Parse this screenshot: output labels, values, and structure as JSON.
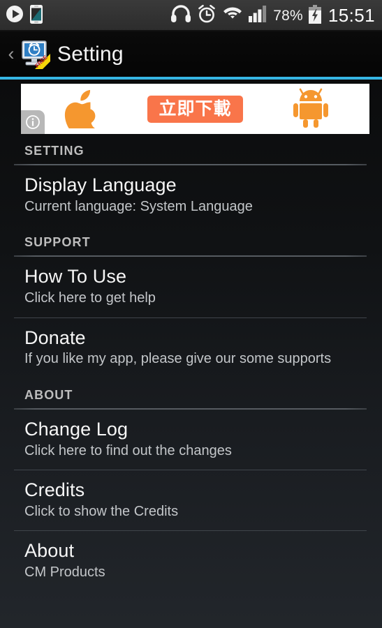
{
  "status_bar": {
    "left_icons": [
      {
        "name": "play-icon",
        "label": "play"
      },
      {
        "name": "phone-device-icon",
        "label": "device"
      }
    ],
    "right_icons": [
      {
        "name": "headphones-icon",
        "label": "headphones"
      },
      {
        "name": "alarm-clock-icon",
        "label": "alarm"
      },
      {
        "name": "wifi-icon",
        "label": "wifi"
      },
      {
        "name": "signal-bars-icon",
        "label": "signal"
      }
    ],
    "battery_percent": "78%",
    "battery_state": "charging",
    "clock": "15:51"
  },
  "action_bar": {
    "back_label": "‹",
    "app_icon_name": "monitor-alarm-clock-icon",
    "app_icon_ribbon": "FREE",
    "title": "Setting"
  },
  "ad": {
    "left_icon_name": "apple-logo-icon",
    "button_text": "立即下載",
    "right_icon_name": "android-robot-icon",
    "info_badge": "i",
    "accent_color": "#f9754a",
    "background_color": "#ffffff"
  },
  "theme": {
    "accent_line_color": "#36b6e4",
    "title_color": "#f6f6f6",
    "subtitle_color": "#c3c6c9",
    "header_color": "#bdbdbd"
  },
  "sections": [
    {
      "header": "SETTING",
      "rows": [
        {
          "title": "Display Language",
          "subtitle": "Current language: System Language"
        }
      ]
    },
    {
      "header": "SUPPORT",
      "rows": [
        {
          "title": "How To Use",
          "subtitle": "Click here to get help"
        },
        {
          "title": "Donate",
          "subtitle": "If you like my app, please give our some supports"
        }
      ]
    },
    {
      "header": "ABOUT",
      "rows": [
        {
          "title": "Change Log",
          "subtitle": "Click here to find out the changes"
        },
        {
          "title": "Credits",
          "subtitle": "Click to show the Credits"
        },
        {
          "title": "About",
          "subtitle": "CM Products"
        }
      ]
    }
  ]
}
